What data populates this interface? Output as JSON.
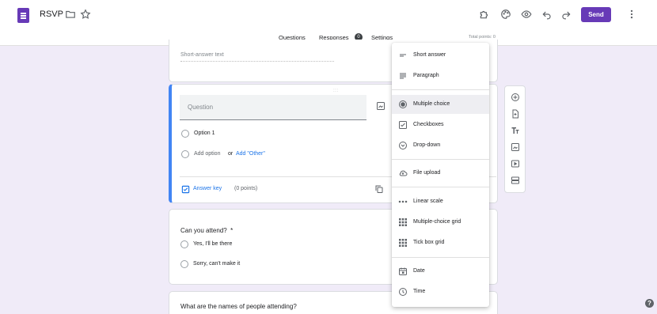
{
  "header": {
    "title": "RSVP",
    "send_label": "Send",
    "tabs": [
      {
        "label": "Questions"
      },
      {
        "label": "Responses"
      },
      {
        "label": "Settings"
      }
    ],
    "responses_count": "0",
    "total_points": "Total points: 0"
  },
  "cards": {
    "short_answer_placeholder": "Short-answer text",
    "active": {
      "drag_handle": ":::",
      "question_placeholder": "Question",
      "option1": "Option 1",
      "add_option": "Add option",
      "or": "or",
      "add_other": "Add \"Other\"",
      "answer_key": "Answer key",
      "points": "(0 points)"
    },
    "attend": {
      "question": "Can you attend?",
      "required_mark": "*",
      "options": [
        "Yes,  I'll be there",
        "Sorry, can't make it"
      ]
    },
    "names": {
      "question": "What are the names of people attending?"
    }
  },
  "menu": {
    "items": [
      {
        "label": "Short answer",
        "icon": "short-answer-icon"
      },
      {
        "label": "Paragraph",
        "icon": "paragraph-icon"
      },
      {
        "label": "Multiple choice",
        "icon": "radio-icon",
        "selected": true
      },
      {
        "label": "Checkboxes",
        "icon": "checkbox-icon"
      },
      {
        "label": "Drop-down",
        "icon": "dropdown-icon"
      },
      {
        "label": "File upload",
        "icon": "upload-icon"
      },
      {
        "label": "Linear scale",
        "icon": "linear-scale-icon"
      },
      {
        "label": "Multiple-choice grid",
        "icon": "grid-icon"
      },
      {
        "label": "Tick box grid",
        "icon": "grid-icon"
      },
      {
        "label": "Date",
        "icon": "calendar-icon"
      },
      {
        "label": "Time",
        "icon": "clock-icon"
      }
    ]
  },
  "colors": {
    "accent": "#673ab7",
    "background": "#f0ebf8",
    "link": "#1a73e8",
    "active_border": "#4285f4"
  }
}
